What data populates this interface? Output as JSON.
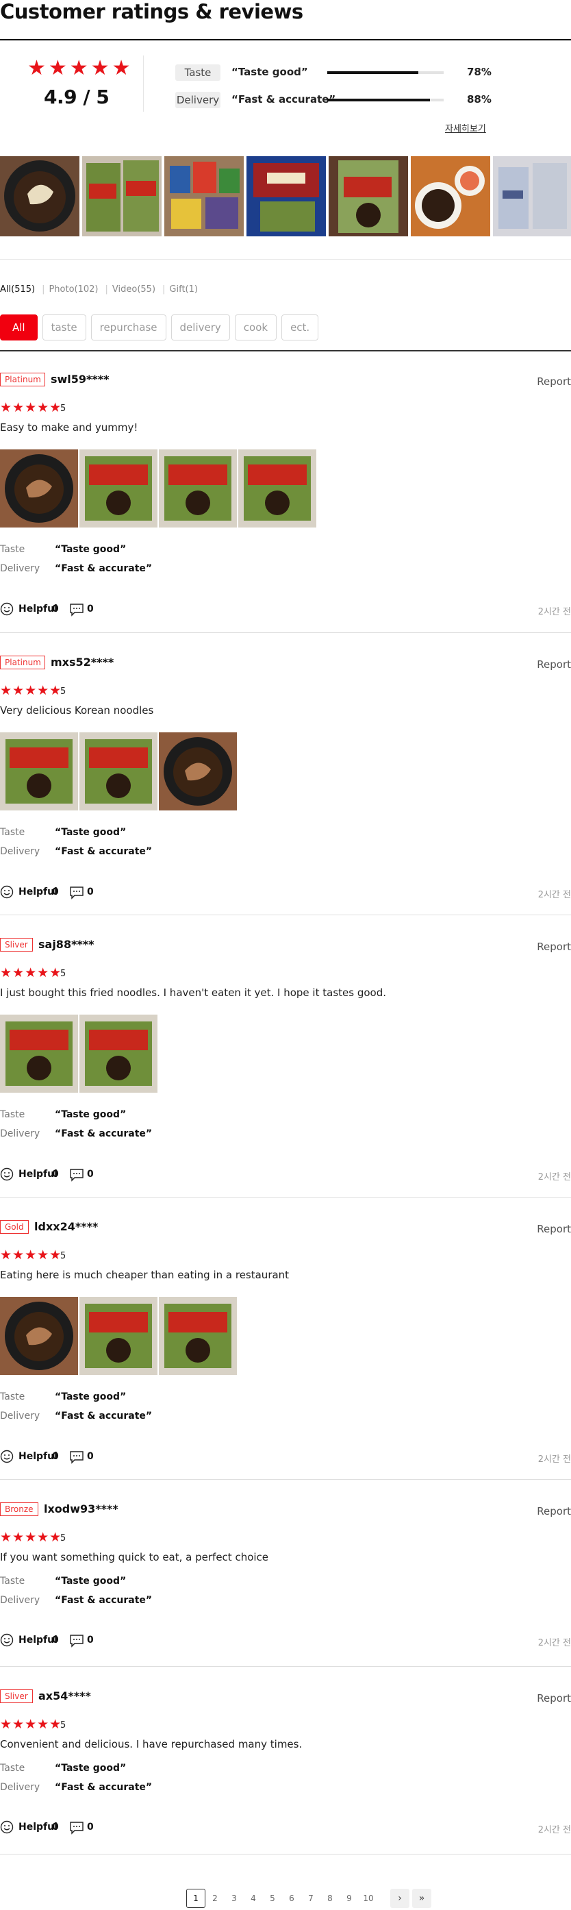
{
  "header": {
    "title": "Customer ratings & reviews"
  },
  "summary": {
    "stars": "★★★★★",
    "score": "4.9 / 5",
    "attributes": [
      {
        "label": "Taste",
        "value": "“Taste good”",
        "percent_text": "78%",
        "percent": 78
      },
      {
        "label": "Delivery",
        "value": "“Fast & accurate”",
        "percent_text": "88%",
        "percent": 88
      }
    ],
    "more_link": "자세히보기"
  },
  "filters": {
    "tabs": [
      {
        "label": "All(515)",
        "active": true
      },
      {
        "label": "Photo(102)",
        "active": false
      },
      {
        "label": "Video(55)",
        "active": false
      },
      {
        "label": "Gift(1)",
        "active": false
      }
    ],
    "chips": [
      "All",
      "taste",
      "repurchase",
      "delivery",
      "cook",
      "ect."
    ]
  },
  "reviews": [
    {
      "badge": "Platinum",
      "user": "swl59****",
      "stars": "★★★★★",
      "rating": "5",
      "text": "Easy to make and yummy!",
      "photos": [
        "plate",
        "pack",
        "pack",
        "pack"
      ],
      "taste_label": "Taste",
      "taste": "“Taste good”",
      "delivery_label": "Delivery",
      "delivery": "“Fast & accurate”",
      "helpful_label": "Helpful",
      "helpful": "0",
      "comments": "0",
      "time": "2시간 전",
      "report": "Report"
    },
    {
      "badge": "Platinum",
      "user": "mxs52****",
      "stars": "★★★★★",
      "rating": "5",
      "text": "Very delicious Korean noodles",
      "photos": [
        "pack",
        "pack",
        "plate"
      ],
      "taste_label": "Taste",
      "taste": "“Taste good”",
      "delivery_label": "Delivery",
      "delivery": "“Fast & accurate”",
      "helpful_label": "Helpful",
      "helpful": "0",
      "comments": "0",
      "time": "2시간 전",
      "report": "Report"
    },
    {
      "badge": "Sliver",
      "user": "saj88****",
      "stars": "★★★★★",
      "rating": "5",
      "text": "I just bought this fried noodles. I haven't eaten it yet. I hope it tastes good.",
      "photos": [
        "pack",
        "pack"
      ],
      "taste_label": "Taste",
      "taste": "“Taste good”",
      "delivery_label": "Delivery",
      "delivery": "“Fast & accurate”",
      "helpful_label": "Helpful",
      "helpful": "0",
      "comments": "0",
      "time": "2시간 전",
      "report": "Report"
    },
    {
      "badge": "Gold",
      "user": "ldxx24****",
      "stars": "★★★★★",
      "rating": "5",
      "text": "Eating here is much cheaper than eating in a restaurant",
      "photos": [
        "plate",
        "pack",
        "pack"
      ],
      "taste_label": "Taste",
      "taste": "“Taste good”",
      "delivery_label": "Delivery",
      "delivery": "“Fast & accurate”",
      "helpful_label": "Helpful",
      "helpful": "0",
      "comments": "0",
      "time": "2시간 전",
      "report": "Report"
    },
    {
      "badge": "Bronze",
      "user": "lxodw93****",
      "stars": "★★★★★",
      "rating": "5",
      "text": "If you want something quick to eat, a perfect choice",
      "photos": [],
      "taste_label": "Taste",
      "taste": "“Taste good”",
      "delivery_label": "Delivery",
      "delivery": "“Fast & accurate”",
      "helpful_label": "Helpful",
      "helpful": "0",
      "comments": "0",
      "time": "2시간 전",
      "report": "Report"
    },
    {
      "badge": "Sliver",
      "user": "ax54****",
      "stars": "★★★★★",
      "rating": "5",
      "text": "Convenient and delicious. I have repurchased many times.",
      "photos": [],
      "taste_label": "Taste",
      "taste": "“Taste good”",
      "delivery_label": "Delivery",
      "delivery": "“Fast & accurate”",
      "helpful_label": "Helpful",
      "helpful": "0",
      "comments": "0",
      "time": "2시간 전",
      "report": "Report"
    }
  ],
  "pagination": {
    "pages": [
      "1",
      "2",
      "3",
      "4",
      "5",
      "6",
      "7",
      "8",
      "9",
      "10"
    ],
    "current": "1",
    "next_icon": "chevron-right-icon",
    "last_icon": "double-chevron-right-icon"
  },
  "colors": {
    "accent": "#f1000f",
    "star": "#e8141a",
    "badge": "#e33333"
  }
}
